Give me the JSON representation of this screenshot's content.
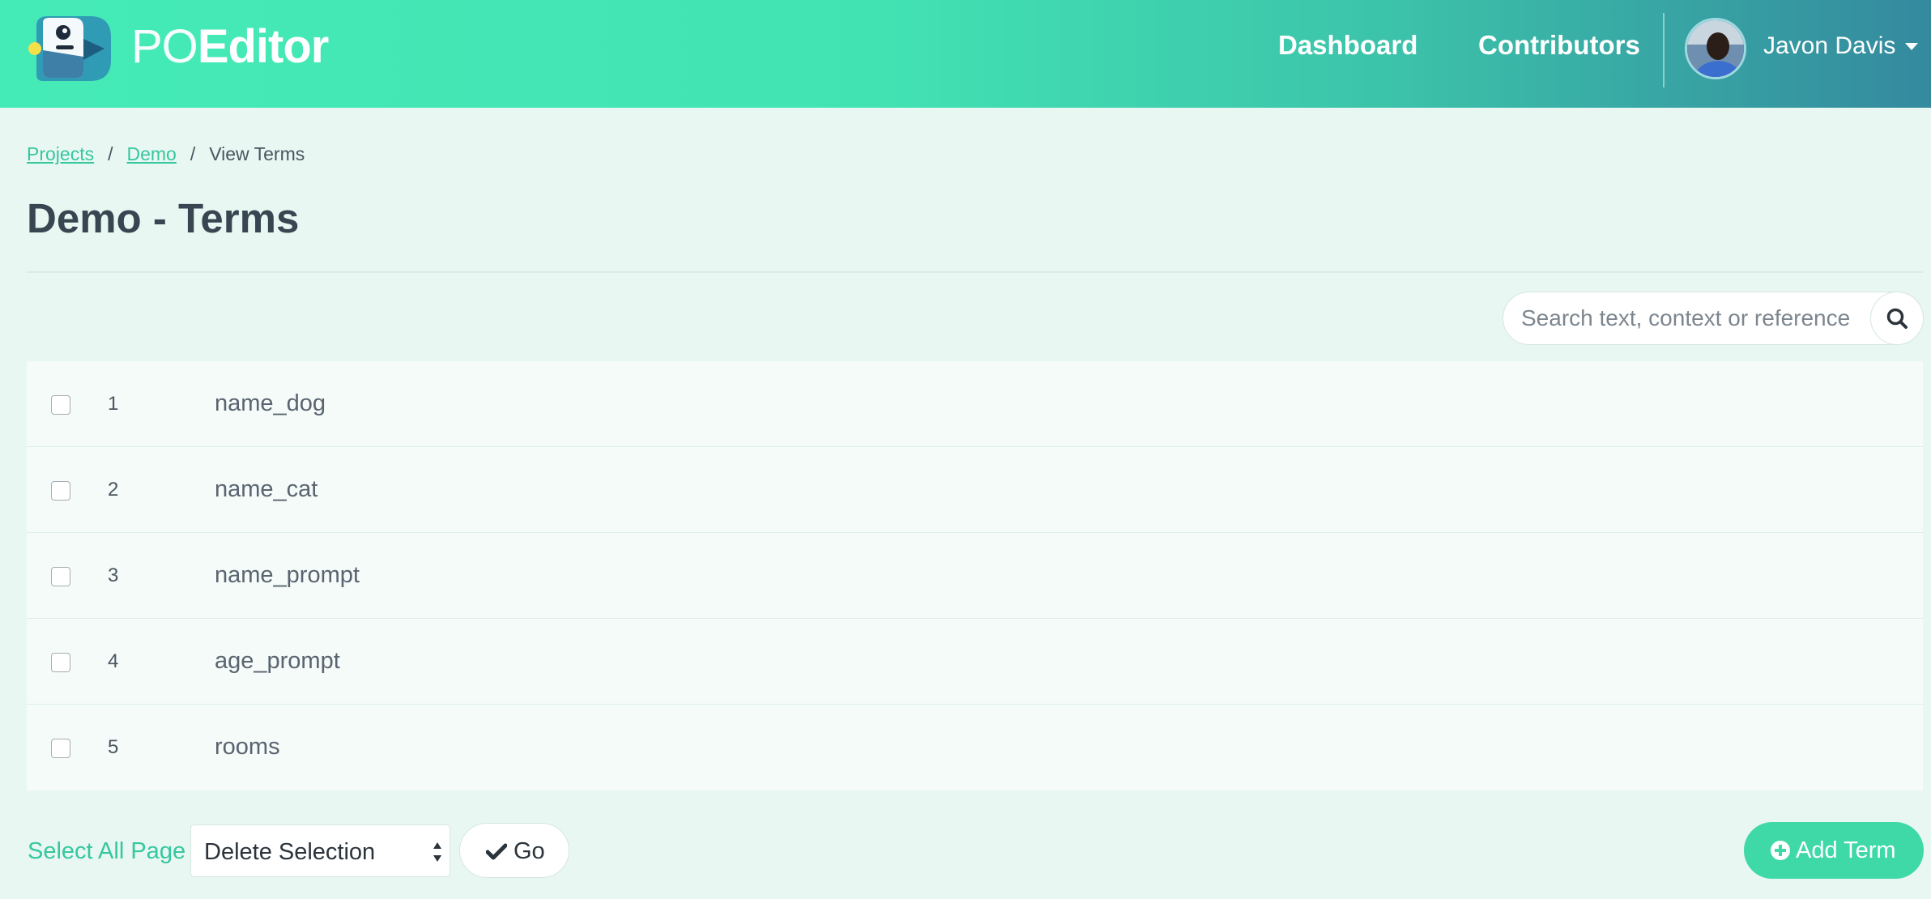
{
  "header": {
    "brand_prefix": "PO",
    "brand_suffix": "Editor",
    "nav": [
      "Dashboard",
      "Contributors"
    ],
    "user_name": "Javon Davis",
    "icons": {
      "logo": "poeditor-logo-icon",
      "caret": "caret-down-icon"
    }
  },
  "breadcrumb": {
    "items": [
      "Projects",
      "Demo",
      "View Terms"
    ],
    "separator": "/"
  },
  "page_title": "Demo - Terms",
  "search": {
    "placeholder": "Search text, context or reference",
    "value": "",
    "icon": "search-icon"
  },
  "terms": [
    {
      "num": "1",
      "name": "name_dog",
      "checked": false
    },
    {
      "num": "2",
      "name": "name_cat",
      "checked": false
    },
    {
      "num": "3",
      "name": "name_prompt",
      "checked": false
    },
    {
      "num": "4",
      "name": "age_prompt",
      "checked": false
    },
    {
      "num": "5",
      "name": "rooms",
      "checked": false
    }
  ],
  "footer": {
    "select_all": "Select All Page",
    "bulk_action": "Delete Selection",
    "go_label": "Go",
    "go_icon": "check-icon",
    "add_label": "Add Term",
    "add_icon": "plus-circle-icon"
  },
  "colors": {
    "accent": "#3fd9a7",
    "link": "#36c79e",
    "background": "#e9f7f2",
    "header_start": "#45ebb6",
    "header_end": "#34899e",
    "title_text": "#384652"
  }
}
